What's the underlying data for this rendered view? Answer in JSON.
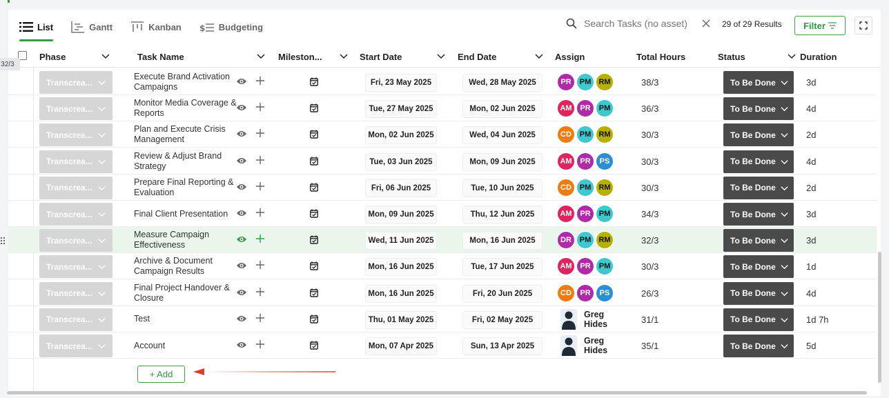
{
  "views": [
    {
      "label": "List",
      "icon": "list-icon",
      "active": true
    },
    {
      "label": "Gantt",
      "icon": "gantt-icon",
      "active": false
    },
    {
      "label": "Kanban",
      "icon": "kanban-icon",
      "active": false
    },
    {
      "label": "Budgeting",
      "icon": "budgeting-icon",
      "active": false
    }
  ],
  "search": {
    "placeholder": "Search Tasks (no asset)",
    "value": ""
  },
  "results_text": "29 of 29 Results",
  "filter_label": "Filter",
  "row_count_badge": "32/3",
  "columns": {
    "phase": "Phase",
    "task_name": "Task Name",
    "milestone": "Mileston...",
    "start_date": "Start Date",
    "end_date": "End Date",
    "assign": "Assign",
    "total_hours": "Total Hours",
    "status": "Status",
    "duration": "Duration"
  },
  "colors": {
    "accent": "#2f9e44",
    "status_bg": "#4a4a4a",
    "phase_bg": "#d6d6d6",
    "PR": "#b02aa8",
    "PM": "#3ec8d0",
    "RM": "#b8b000",
    "AM": "#e0245e",
    "CD": "#f07c0f",
    "PS": "#2b8fd6",
    "DR": "#b02aa8"
  },
  "rows": [
    {
      "phase": "Transcrea...",
      "task": "Execute Brand Activation Campaigns",
      "start": "Fri, 23 May 2025",
      "end": "Wed, 28 May 2025",
      "assign": [
        "PR",
        "PM",
        "RM"
      ],
      "hours": "38/3",
      "status": "To Be Done",
      "duration": "3d"
    },
    {
      "phase": "Transcrea...",
      "task": "Monitor Media Coverage & Reports",
      "start": "Tue, 27 May 2025",
      "end": "Mon, 02 Jun 2025",
      "assign": [
        "AM",
        "PR",
        "PM"
      ],
      "hours": "36/3",
      "status": "To Be Done",
      "duration": "4d"
    },
    {
      "phase": "Transcrea...",
      "task": "Plan and Execute Crisis Management",
      "start": "Mon, 02 Jun 2025",
      "end": "Wed, 04 Jun 2025",
      "assign": [
        "CD",
        "PM",
        "RM"
      ],
      "hours": "30/3",
      "status": "To Be Done",
      "duration": "2d"
    },
    {
      "phase": "Transcrea...",
      "task": "Review & Adjust Brand Strategy",
      "start": "Tue, 03 Jun 2025",
      "end": "Mon, 09 Jun 2025",
      "assign": [
        "AM",
        "PR",
        "PS"
      ],
      "hours": "30/3",
      "status": "To Be Done",
      "duration": "4d"
    },
    {
      "phase": "Transcrea...",
      "task": "Prepare Final Reporting & Evaluation",
      "start": "Fri, 06 Jun 2025",
      "end": "Tue, 10 Jun 2025",
      "assign": [
        "CD",
        "PM",
        "RM"
      ],
      "hours": "30/3",
      "status": "To Be Done",
      "duration": "2d"
    },
    {
      "phase": "Transcrea...",
      "task": "Final Client Presentation",
      "start": "Mon, 09 Jun 2025",
      "end": "Thu, 12 Jun 2025",
      "assign": [
        "AM",
        "PR",
        "PM"
      ],
      "hours": "34/3",
      "status": "To Be Done",
      "duration": "3d"
    },
    {
      "phase": "Transcrea...",
      "task": "Measure Campaign Effectiveness",
      "start": "Wed, 11 Jun 2025",
      "end": "Mon, 16 Jun 2025",
      "assign": [
        "DR",
        "PM",
        "RM"
      ],
      "hours": "32/3",
      "status": "To Be Done",
      "duration": "3d",
      "highlight": true
    },
    {
      "phase": "Transcrea...",
      "task": "Archive & Document Campaign Results",
      "start": "Mon, 16 Jun 2025",
      "end": "Tue, 17 Jun 2025",
      "assign": [
        "AM",
        "PR",
        "PM"
      ],
      "hours": "30/3",
      "status": "To Be Done",
      "duration": "1d"
    },
    {
      "phase": "Transcrea...",
      "task": "Final Project Handover & Closure",
      "start": "Mon, 16 Jun 2025",
      "end": "Fri, 20 Jun 2025",
      "assign": [
        "CD",
        "PR",
        "PS"
      ],
      "hours": "26/3",
      "status": "To Be Done",
      "duration": "4d"
    },
    {
      "phase": "Transcrea...",
      "task": "Test",
      "start": "Thu, 01 May 2025",
      "end": "Fri, 02 May 2025",
      "person": "Greg Hides",
      "hours": "31/1",
      "status": "To Be Done",
      "duration": "1d 7h"
    },
    {
      "phase": "Transcrea...",
      "task": "Account",
      "start": "Mon, 07 Apr 2025",
      "end": "Sun, 13 Apr 2025",
      "person": "Greg Hides",
      "hours": "35/1",
      "status": "To Be Done",
      "duration": "5d"
    }
  ],
  "add_label": "+ Add"
}
